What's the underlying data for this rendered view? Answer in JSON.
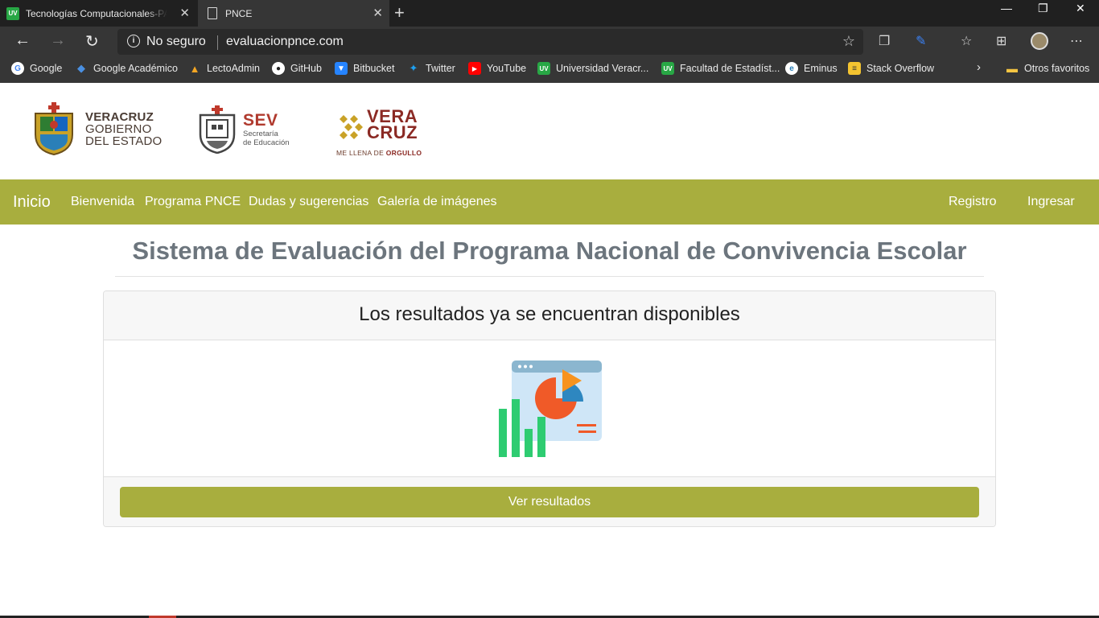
{
  "browser": {
    "tabs": [
      {
        "title": "Tecnologías Computacionales-PA",
        "favicon": "uv-icon"
      },
      {
        "title": "PNCE",
        "favicon": "page-icon"
      }
    ],
    "security_label": "No seguro",
    "url": "evaluacionpnce.com",
    "bookmarks": [
      {
        "label": "Google",
        "icon": "google-icon"
      },
      {
        "label": "Google Académico",
        "icon": "scholar-icon"
      },
      {
        "label": "LectoAdmin",
        "icon": "firebase-icon"
      },
      {
        "label": "GitHub",
        "icon": "github-icon"
      },
      {
        "label": "Bitbucket",
        "icon": "bitbucket-icon"
      },
      {
        "label": "Twitter",
        "icon": "twitter-icon"
      },
      {
        "label": "YouTube",
        "icon": "youtube-icon"
      },
      {
        "label": "Universidad Veracr...",
        "icon": "uv-icon"
      },
      {
        "label": "Facultad de Estadíst...",
        "icon": "uv-icon"
      },
      {
        "label": "Eminus",
        "icon": "eminus-icon"
      },
      {
        "label": "Stack Overflow",
        "icon": "stackoverflow-icon"
      }
    ],
    "other_favorites": "Otros favoritos"
  },
  "logos": {
    "veracruz": {
      "line1": "VERACRUZ",
      "line2": "GOBIERNO",
      "line3": "DEL ESTADO"
    },
    "sev": {
      "big": "SEV",
      "line1": "Secretaría",
      "line2": "de Educación"
    },
    "vc": {
      "line1": "VERA",
      "line2": "CRUZ",
      "slogan_a": "ME LLENA DE ",
      "slogan_b": "ORGULLO"
    }
  },
  "nav": {
    "brand": "Inicio",
    "links": [
      "Bienvenida",
      "Programa PNCE",
      "Dudas y sugerencias",
      "Galería de imágenes"
    ],
    "right": [
      "Registro",
      "Ingresar"
    ]
  },
  "main": {
    "title": "Sistema de Evaluación del Programa Nacional de Convivencia Escolar",
    "card_title": "Los resultados ya se encuentran disponibles",
    "button": "Ver resultados"
  },
  "colors": {
    "accent": "#a8ae3e",
    "chrome": "#363636"
  }
}
